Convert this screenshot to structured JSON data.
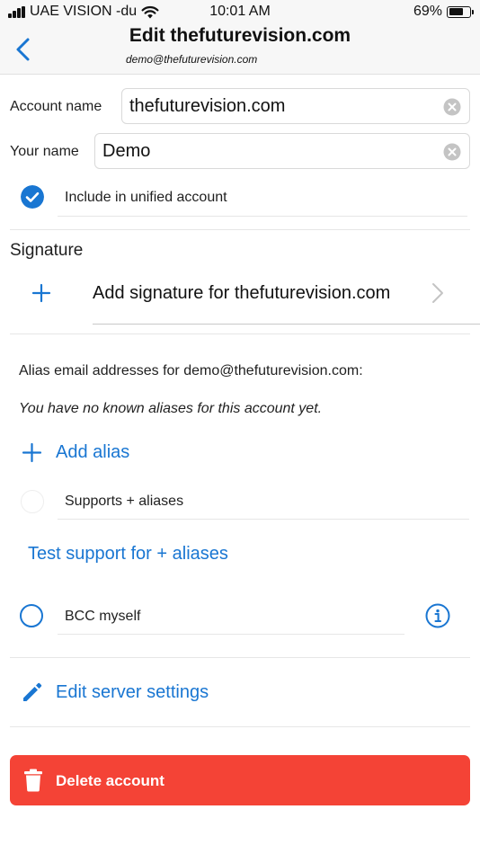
{
  "status_bar": {
    "carrier": "UAE VISION -du",
    "time": "10:01 AM",
    "battery_percent": "69%",
    "battery_level": 0.69
  },
  "nav": {
    "title": "Edit thefuturevision.com",
    "subtitle": "demo@thefuturevision.com"
  },
  "account_name": {
    "label": "Account name",
    "value": "thefuturevision.com"
  },
  "your_name": {
    "label": "Your name",
    "value": "Demo"
  },
  "unified": {
    "label": "Include in unified account",
    "checked": true
  },
  "signature": {
    "title": "Signature",
    "add_label": "Add signature for thefuturevision.com"
  },
  "alias": {
    "header": "Alias email addresses for demo@thefuturevision.com:",
    "empty": "You have no known aliases for this account yet.",
    "add_label": "Add alias",
    "supports_label": "Supports + aliases",
    "test_label": "Test support for + aliases"
  },
  "bcc": {
    "label": "BCC myself",
    "checked": false
  },
  "server": {
    "label": "Edit server settings"
  },
  "delete": {
    "label": "Delete account"
  },
  "colors": {
    "accent": "#1976d2",
    "danger": "#f44336",
    "bar_background": "#f7f7f7"
  },
  "icons": [
    "signal-icon",
    "wifi-icon",
    "battery-icon",
    "back-chevron-icon",
    "clear-icon",
    "check-circle-icon",
    "plus-icon",
    "chevron-right-icon",
    "radio-icon",
    "info-icon",
    "pencil-icon",
    "trash-icon"
  ]
}
